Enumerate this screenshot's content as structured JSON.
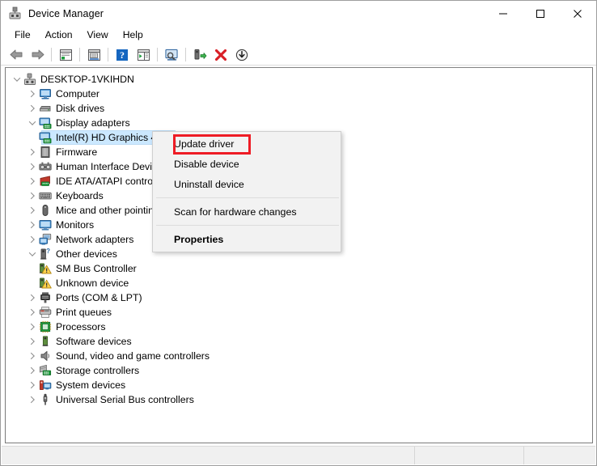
{
  "window": {
    "title": "Device Manager",
    "icon": "device-manager-icon",
    "controls": {
      "minimize": "—",
      "maximize": "□",
      "close": "✕"
    }
  },
  "menubar": {
    "items": [
      {
        "label": "File"
      },
      {
        "label": "Action"
      },
      {
        "label": "View"
      },
      {
        "label": "Help"
      }
    ]
  },
  "toolbar": {
    "buttons": [
      {
        "name": "back-icon",
        "tooltip": "Back"
      },
      {
        "name": "forward-icon",
        "tooltip": "Forward"
      },
      {
        "name": "separator-1"
      },
      {
        "name": "show-hide-console-tree-icon",
        "tooltip": "Show/Hide Console Tree"
      },
      {
        "name": "separator-2"
      },
      {
        "name": "properties-icon",
        "tooltip": "Properties"
      },
      {
        "name": "separator-3"
      },
      {
        "name": "help-icon",
        "tooltip": "Help"
      },
      {
        "name": "show-hide-action-pane-icon",
        "tooltip": "Show/Hide Action Pane"
      },
      {
        "name": "separator-4"
      },
      {
        "name": "scan-for-hardware-changes-icon",
        "tooltip": "Scan for hardware changes"
      },
      {
        "name": "separator-5"
      },
      {
        "name": "update-driver-icon",
        "tooltip": "Update driver"
      },
      {
        "name": "uninstall-device-icon",
        "tooltip": "Uninstall device"
      },
      {
        "name": "disable-device-icon",
        "tooltip": "Disable device"
      }
    ]
  },
  "tree": {
    "root": {
      "label": "DESKTOP-1VKIHDN",
      "icon": "computer-root-icon",
      "expanded": true
    },
    "items": [
      {
        "label": "Computer",
        "icon": "computer-icon",
        "state": "collapsed",
        "depth": 1
      },
      {
        "label": "Disk drives",
        "icon": "disk-drive-icon",
        "state": "collapsed",
        "depth": 1
      },
      {
        "label": "Display adapters",
        "icon": "display-adapter-icon",
        "state": "expanded",
        "depth": 1
      },
      {
        "label": "Intel(R) HD Graphics 4000",
        "icon": "display-adapter-icon",
        "state": "leaf",
        "depth": 2,
        "selected": true
      },
      {
        "label": "Firmware",
        "icon": "firmware-icon",
        "state": "collapsed",
        "depth": 1
      },
      {
        "label": "Human Interface Devices",
        "icon": "hid-icon",
        "state": "collapsed",
        "depth": 1
      },
      {
        "label": "IDE ATA/ATAPI controllers",
        "icon": "ide-controller-icon",
        "state": "collapsed",
        "depth": 1
      },
      {
        "label": "Keyboards",
        "icon": "keyboard-icon",
        "state": "collapsed",
        "depth": 1
      },
      {
        "label": "Mice and other pointing devices",
        "icon": "mouse-icon",
        "state": "collapsed",
        "depth": 1
      },
      {
        "label": "Monitors",
        "icon": "monitor-icon",
        "state": "collapsed",
        "depth": 1
      },
      {
        "label": "Network adapters",
        "icon": "network-adapter-icon",
        "state": "collapsed",
        "depth": 1
      },
      {
        "label": "Other devices",
        "icon": "other-devices-icon",
        "state": "expanded",
        "depth": 1
      },
      {
        "label": "SM Bus Controller",
        "icon": "unknown-device-warning-icon",
        "state": "leaf",
        "depth": 2
      },
      {
        "label": "Unknown device",
        "icon": "unknown-device-warning-icon",
        "state": "leaf",
        "depth": 2
      },
      {
        "label": "Ports (COM & LPT)",
        "icon": "port-icon",
        "state": "collapsed",
        "depth": 1
      },
      {
        "label": "Print queues",
        "icon": "printer-icon",
        "state": "collapsed",
        "depth": 1
      },
      {
        "label": "Processors",
        "icon": "processor-icon",
        "state": "collapsed",
        "depth": 1
      },
      {
        "label": "Software devices",
        "icon": "software-device-icon",
        "state": "collapsed",
        "depth": 1
      },
      {
        "label": "Sound, video and game controllers",
        "icon": "sound-icon",
        "state": "collapsed",
        "depth": 1
      },
      {
        "label": "Storage controllers",
        "icon": "storage-controller-icon",
        "state": "collapsed",
        "depth": 1
      },
      {
        "label": "System devices",
        "icon": "system-device-icon",
        "state": "collapsed",
        "depth": 1
      },
      {
        "label": "Universal Serial Bus controllers",
        "icon": "usb-controller-icon",
        "state": "collapsed",
        "depth": 1
      }
    ]
  },
  "context_menu": {
    "items": [
      {
        "label": "Update driver",
        "bold": false,
        "highlighted": true
      },
      {
        "label": "Disable device",
        "bold": false
      },
      {
        "label": "Uninstall device",
        "bold": false
      },
      {
        "separator": true
      },
      {
        "label": "Scan for hardware changes",
        "bold": false
      },
      {
        "separator": true
      },
      {
        "label": "Properties",
        "bold": true
      }
    ]
  },
  "statusbar": {
    "panes": [
      "",
      "",
      ""
    ]
  },
  "colors": {
    "highlight_box": "#ee1c25",
    "selection": "#cbe8ff",
    "menu_background": "#f2f2f2",
    "window_background": "#ffffff"
  }
}
